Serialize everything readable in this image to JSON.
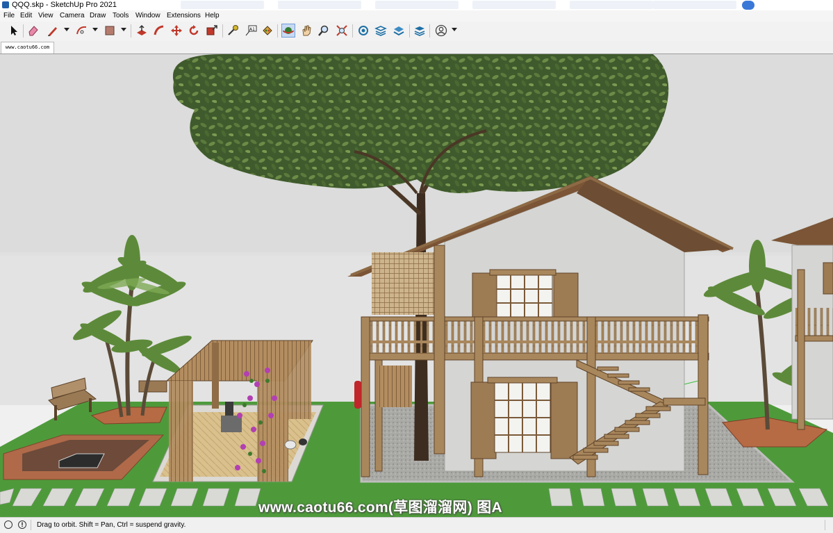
{
  "window": {
    "title": "QQQ.skp - SketchUp Pro 2021"
  },
  "menu": {
    "items": [
      "File",
      "Edit",
      "View",
      "Camera",
      "Draw",
      "Tools",
      "Window",
      "Extensions",
      "Help"
    ]
  },
  "toolbar": {
    "tools": [
      {
        "name": "select-tool",
        "icon": "arrow-cursor-icon"
      },
      {
        "name": "eraser-tool",
        "icon": "eraser-icon"
      },
      {
        "name": "line-tool",
        "icon": "pencil-icon"
      },
      {
        "name": "arc-tool",
        "icon": "arc-icon"
      },
      {
        "name": "shape-tool",
        "icon": "rectangle-icon"
      },
      {
        "name": "push-pull-tool",
        "icon": "push-pull-icon"
      },
      {
        "name": "follow-me-tool",
        "icon": "follow-me-icon"
      },
      {
        "name": "move-tool",
        "icon": "move-arrows-icon"
      },
      {
        "name": "rotate-tool",
        "icon": "rotate-icon"
      },
      {
        "name": "scale-tool",
        "icon": "scale-icon"
      },
      {
        "name": "tape-measure-tool",
        "icon": "tape-measure-icon"
      },
      {
        "name": "text-tool",
        "icon": "text-a1-icon"
      },
      {
        "name": "paint-bucket-tool",
        "icon": "paint-bucket-icon"
      },
      {
        "name": "orbit-tool",
        "icon": "orbit-icon",
        "active": true
      },
      {
        "name": "pan-tool",
        "icon": "hand-icon"
      },
      {
        "name": "zoom-tool",
        "icon": "magnifier-icon"
      },
      {
        "name": "zoom-extents-tool",
        "icon": "zoom-extents-icon"
      },
      {
        "name": "warehouse-tool",
        "icon": "warehouse-icon"
      },
      {
        "name": "extension-warehouse-tool",
        "icon": "extension-warehouse-icon"
      },
      {
        "name": "send-to-layout-tool",
        "icon": "layout-icon"
      },
      {
        "name": "extension-manager-tool",
        "icon": "extension-manager-icon"
      },
      {
        "name": "account-tool",
        "icon": "user-circle-icon"
      }
    ]
  },
  "scenes": {
    "tabs": [
      "www.caotu66.com"
    ]
  },
  "viewport": {
    "watermark": "www.caotu66.com(草图溜溜网) 图A",
    "colors": {
      "sky": "#d8d9d8",
      "ground": "#e2e2e2",
      "grass": "#4f9a3c",
      "wood": "#a8865c",
      "wall": "#d4d4d2"
    }
  },
  "status": {
    "message": "Drag to orbit. Shift = Pan, Ctrl = suspend gravity."
  }
}
